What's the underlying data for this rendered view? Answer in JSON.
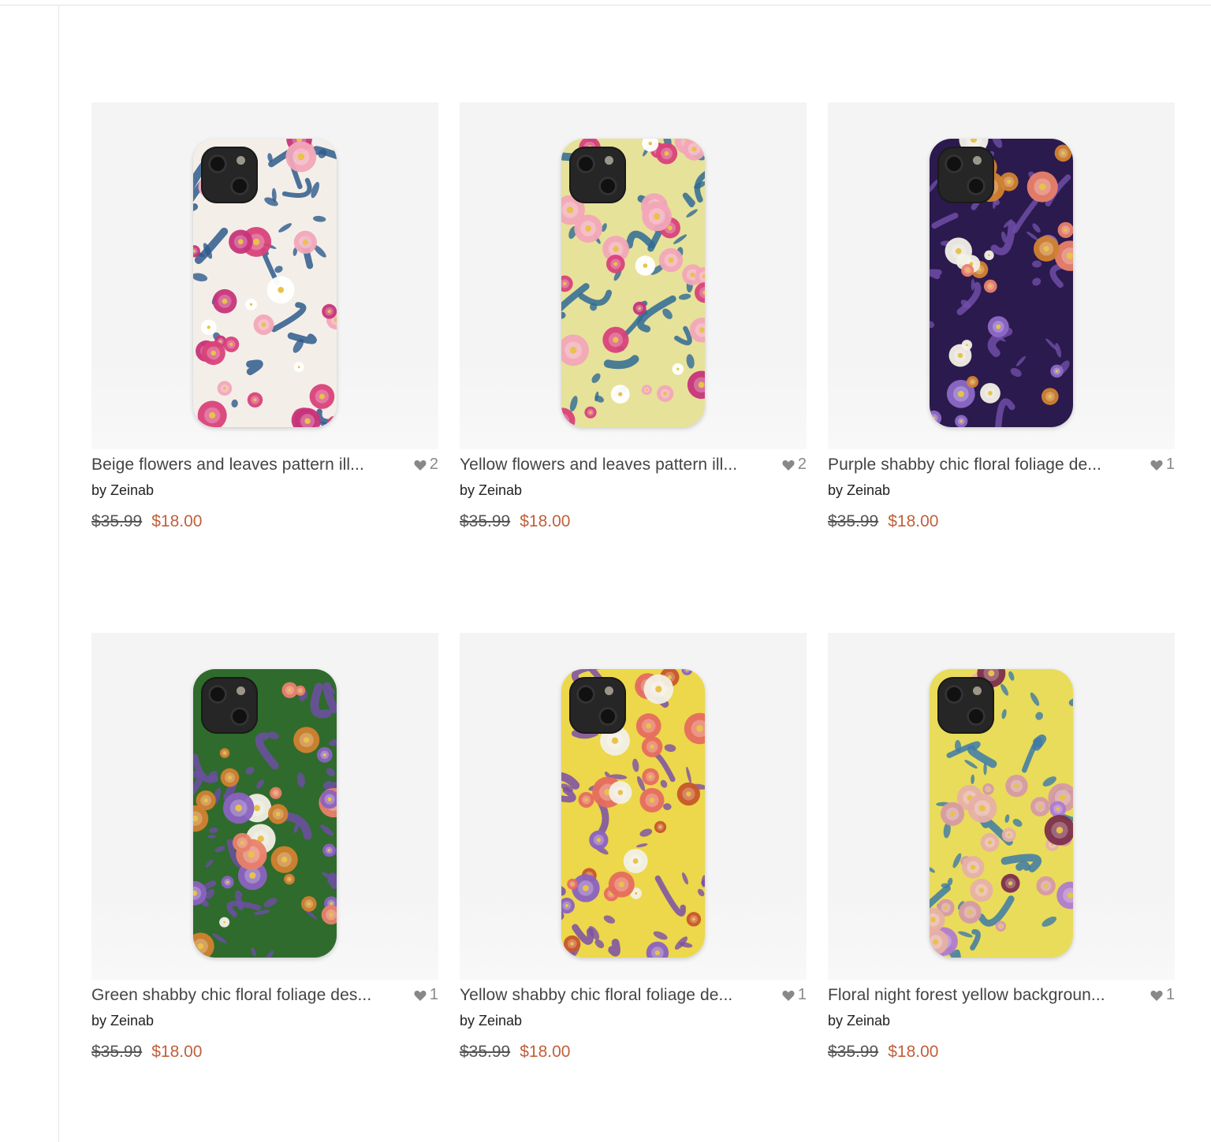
{
  "products": [
    {
      "title": "Beige flowers and leaves pattern ill...",
      "likes": "2",
      "byline": "by Zeinab",
      "old_price": "$35.99",
      "new_price": "$18.00",
      "pattern": {
        "bg": "#f3efe8",
        "vine": "#2e5a8c",
        "flowers": [
          "#d9417a",
          "#f2a7b8",
          "#ffffff",
          "#c7347a"
        ]
      }
    },
    {
      "title": "Yellow flowers and leaves pattern ill...",
      "likes": "2",
      "byline": "by Zeinab",
      "old_price": "$35.99",
      "new_price": "$18.00",
      "pattern": {
        "bg": "#e6e29a",
        "vine": "#2f6a95",
        "flowers": [
          "#d9417a",
          "#f2a7b8",
          "#ffffff",
          "#c7347a"
        ]
      }
    },
    {
      "title": "Purple shabby chic floral foliage de...",
      "likes": "1",
      "byline": "by Zeinab",
      "old_price": "$35.99",
      "new_price": "$18.00",
      "pattern": {
        "bg": "#2b1a4d",
        "vine": "#6f4ea8",
        "flowers": [
          "#e9816a",
          "#f2f0e6",
          "#d2822f",
          "#8c69c6"
        ]
      }
    },
    {
      "title": "Green shabby chic floral foliage des...",
      "likes": "1",
      "byline": "by Zeinab",
      "old_price": "$35.99",
      "new_price": "$18.00",
      "pattern": {
        "bg": "#2f6b2c",
        "vine": "#6e4ea6",
        "flowers": [
          "#e9816a",
          "#f2f0e6",
          "#d2822f",
          "#8b62c0"
        ]
      }
    },
    {
      "title": "Yellow shabby chic floral foliage de...",
      "likes": "1",
      "byline": "by Zeinab",
      "old_price": "$35.99",
      "new_price": "$18.00",
      "pattern": {
        "bg": "#ecd84a",
        "vine": "#7a4fa8",
        "flowers": [
          "#e66d5e",
          "#f2f0e6",
          "#c9562a",
          "#8b62c0"
        ]
      }
    },
    {
      "title": "Floral night forest yellow backgroun...",
      "likes": "1",
      "byline": "by Zeinab",
      "old_price": "$35.99",
      "new_price": "$18.00",
      "pattern": {
        "bg": "#e9dc5a",
        "vine": "#3c7aa8",
        "flowers": [
          "#d69aa4",
          "#b07bd0",
          "#7c2f4c",
          "#e7b0a7"
        ]
      }
    }
  ]
}
